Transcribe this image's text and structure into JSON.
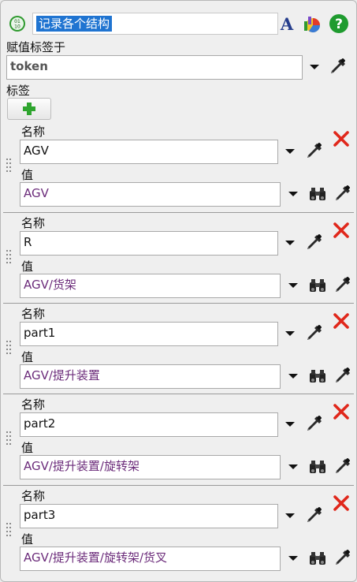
{
  "header": {
    "title": "记录各个结构",
    "icons": [
      "activity-logo-icon",
      "text-format-icon",
      "chart-icon",
      "help-icon"
    ]
  },
  "assign_label": "赋值标签于",
  "assign_value": "token",
  "labels_heading": "标签",
  "entries": [
    {
      "name_label": "名称",
      "name": "AGV",
      "value_label": "值",
      "value": "AGV"
    },
    {
      "name_label": "名称",
      "name": "R",
      "value_label": "值",
      "value": "AGV/货架"
    },
    {
      "name_label": "名称",
      "name": "part1",
      "value_label": "值",
      "value": "AGV/提升装置"
    },
    {
      "name_label": "名称",
      "name": "part2",
      "value_label": "值",
      "value": "AGV/提升装置/旋转架"
    },
    {
      "name_label": "名称",
      "name": "part3",
      "value_label": "值",
      "value": "AGV/提升装置/旋转架/货叉"
    }
  ],
  "colors": {
    "selection": "#1f74d1",
    "value_text": "#6b2b7a",
    "delete": "#e0271b",
    "add": "#2fa52f"
  }
}
